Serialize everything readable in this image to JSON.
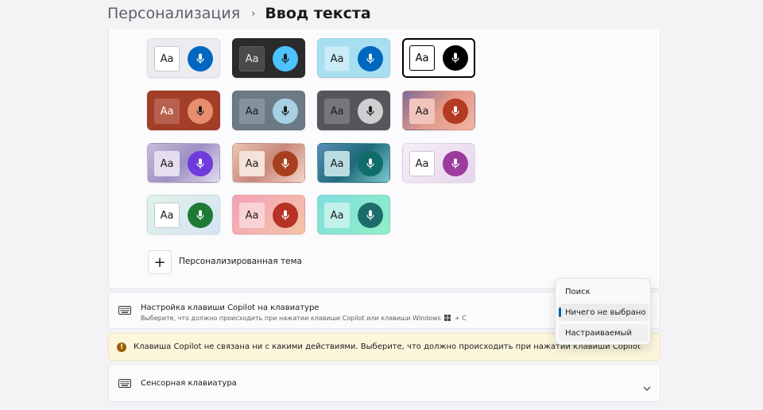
{
  "breadcrumb": {
    "parent": "Персонализация",
    "separator": "›",
    "current": "Ввод текста"
  },
  "themes": {
    "aa_label": "Aa",
    "add_button_symbol": "+",
    "custom_theme_label": "Персонализированная тема",
    "tiles": [
      {
        "name": "theme-light-blue",
        "bg": "#ececf0",
        "aa_bg": "#ffffff",
        "aa_color": "#1b1b1b",
        "mic_bg": "#0067c0",
        "mic_color": "#ffffff",
        "aa_border": "#c8c8cc"
      },
      {
        "name": "theme-dark",
        "bg": "#2b2b2b",
        "aa_bg": "#4a4a4a",
        "aa_color": "#e8e8e8",
        "mic_bg": "#4cc2ff",
        "mic_color": "#1b1b1b",
        "aa_border": "#5a5a5a"
      },
      {
        "name": "theme-light-cyan",
        "bg": "#a8dff0",
        "aa_bg": "#c9ecf7",
        "aa_color": "#1b1b1b",
        "mic_bg": "#0067c0",
        "mic_color": "#ffffff",
        "aa_border": "#b6e3f3"
      },
      {
        "name": "theme-high-contrast",
        "bg": "#ffffff",
        "aa_bg": "#ffffff",
        "aa_color": "#000000",
        "mic_bg": "#000000",
        "mic_color": "#ffffff",
        "aa_border": "#000000",
        "selected": true
      },
      {
        "name": "theme-rust",
        "bg": "#a33e29",
        "aa_bg": "#b8604e",
        "aa_color": "#ffffff",
        "mic_bg": "#e88e6e",
        "mic_color": "#1b1b1b",
        "aa_border": "#b8604e"
      },
      {
        "name": "theme-slate",
        "bg": "#6b7a85",
        "aa_bg": "#8593a0",
        "aa_color": "#1b1b1b",
        "mic_bg": "#a8d0e4",
        "mic_color": "#1b1b1b",
        "aa_border": "#8593a0"
      },
      {
        "name": "theme-graphite",
        "bg": "#55565a",
        "aa_bg": "#76777b",
        "aa_color": "#1b1b1b",
        "mic_bg": "#cfcfd2",
        "mic_color": "#1b1b1b",
        "aa_border": "#76777b"
      },
      {
        "name": "theme-sunset",
        "bg": "linear-gradient(135deg,#7d6a9a 0%,#e39a8a 50%,#f0b4a2 100%)",
        "aa_bg": "#f1c5bd",
        "aa_color": "#1b1b1b",
        "mic_bg": "#b53a22",
        "mic_color": "#ffffff",
        "aa_border": "#f1c5bd"
      },
      {
        "name": "theme-lavender",
        "bg": "linear-gradient(135deg,#c5bcd8 0%,#9e90c4 50%,#e2dcee 100%)",
        "aa_bg": "#e4def0",
        "aa_color": "#1b1b1b",
        "mic_bg": "#6f3bdc",
        "mic_color": "#ffffff",
        "aa_border": "#e4def0"
      },
      {
        "name": "theme-peach",
        "bg": "linear-gradient(135deg,#e9c6b6 0%,#c9877a 50%,#f2d7c8 100%)",
        "aa_bg": "#f5e2d8",
        "aa_color": "#1b1b1b",
        "mic_bg": "#a8401f",
        "mic_color": "#ffffff",
        "aa_border": "#f5e2d8"
      },
      {
        "name": "theme-ocean",
        "bg": "linear-gradient(135deg,#5a8fb5 0%,#1d6a7a 50%,#7fc9cf 100%)",
        "aa_bg": "#b9dce0",
        "aa_color": "#1b1b1b",
        "mic_bg": "#0f6d6a",
        "mic_color": "#ffffff",
        "aa_border": "#b9dce0"
      },
      {
        "name": "theme-orchid",
        "bg": "linear-gradient(135deg,#f7eef7 0%,#e6d5ee 100%)",
        "aa_bg": "#ffffff",
        "aa_color": "#1b1b1b",
        "mic_bg": "#9b3c9e",
        "mic_color": "#ffffff",
        "aa_border": "#c8c8cc"
      },
      {
        "name": "theme-mint",
        "bg": "linear-gradient(135deg,#dff3e8 0%,#d6e3f4 100%)",
        "aa_bg": "#ffffff",
        "aa_color": "#1b1b1b",
        "mic_bg": "#1e7a34",
        "mic_color": "#ffffff",
        "aa_border": "#c8c8cc"
      },
      {
        "name": "theme-rose",
        "bg": "linear-gradient(135deg,#f2a2b8 0%,#f6c3a6 100%)",
        "aa_bg": "#f8d2d5",
        "aa_color": "#1b1b1b",
        "mic_bg": "#b53224",
        "mic_color": "#ffffff",
        "aa_border": "#f8d2d5"
      },
      {
        "name": "theme-aqua",
        "bg": "linear-gradient(135deg,#7fdde0 0%,#8ff0c6 100%)",
        "aa_bg": "#c2f1ea",
        "aa_color": "#1b1b1b",
        "mic_bg": "#1d6c6a",
        "mic_color": "#ffffff",
        "aa_border": "#c2f1ea"
      }
    ]
  },
  "copilot_key": {
    "icon": "keyboard-icon",
    "title": "Настройка клавиши Copilot на клавиатуре",
    "subtitle_before": "Выберите, что должно происходить при нажатии клавиши Copilot или клавиши Windows",
    "subtitle_after": "+ C",
    "windows_icon": "windows-logo-icon"
  },
  "warning": {
    "icon": "info-warning-icon",
    "icon_glyph": "!",
    "text": "Клавиша Copilot не связана ни с какими действиями. Выберите, что должно происходить при нажатии клавиши Copilot"
  },
  "touch_keyboard": {
    "icon": "keyboard-icon",
    "title": "Сенсорная клавиатура",
    "chevron": "chevron-down-icon"
  },
  "dropdown": {
    "items": [
      "Поиск",
      "Ничего не выбрано",
      "Настраиваемый"
    ],
    "selected_index": 1,
    "accent": "#005fb8"
  }
}
